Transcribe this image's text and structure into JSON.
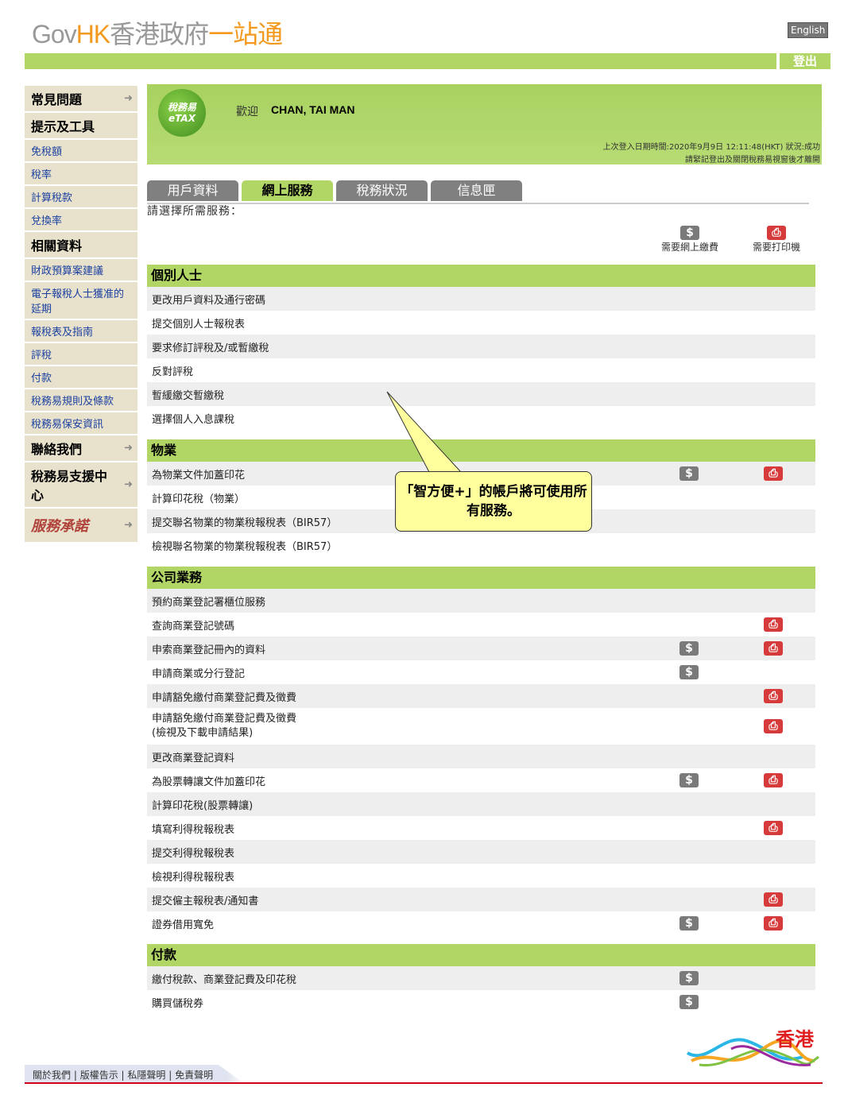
{
  "header": {
    "logo_parts": [
      "Gov",
      "HK",
      "香港政府",
      "一站通"
    ],
    "language_button": "English",
    "logout": "登出"
  },
  "sidebar": {
    "items": [
      {
        "label": "常見問題",
        "big": true,
        "arrow": true
      },
      {
        "label": "提示及工具",
        "big": true
      },
      {
        "label": "免稅額"
      },
      {
        "label": "稅率"
      },
      {
        "label": "計算稅款"
      },
      {
        "label": "兌換率"
      },
      {
        "label": "相關資料",
        "big": true
      },
      {
        "label": "財政預算案建議"
      },
      {
        "label": "電子報稅人士獲准的延期"
      },
      {
        "label": "報稅表及指南"
      },
      {
        "label": "評稅"
      },
      {
        "label": "付款"
      },
      {
        "label": "稅務易規則及條款"
      },
      {
        "label": "稅務易保安資訊"
      },
      {
        "label": "聯絡我們",
        "big": true,
        "arrow": true
      },
      {
        "label": "稅務易支援中心",
        "big": true,
        "arrow": true
      },
      {
        "label": "服務承諾",
        "big": true,
        "arrow": true,
        "logo": true
      }
    ]
  },
  "welcome": {
    "logo_text": "稅務易 eTAX",
    "greeting": "歡迎",
    "user_name": "CHAN, TAI MAN",
    "last_login": "上次登入日期時間:2020年9月9日  12:11:48(HKT)  狀況:成功",
    "reminder": "請緊記登出及關閉稅務易視窗後才離開"
  },
  "tabs": [
    {
      "label": "用戶資料"
    },
    {
      "label": "網上服務",
      "active": true
    },
    {
      "label": "稅務狀況"
    },
    {
      "label": "信息匣"
    }
  ],
  "prompt": "請選擇所需服務：",
  "legend": {
    "payment": "需要網上繳費",
    "printer": "需要打印機"
  },
  "sections": [
    {
      "title": "個別人士",
      "rows": [
        {
          "label": "更改用戶資料及通行密碼"
        },
        {
          "label": "提交個別人士報稅表"
        },
        {
          "label": "要求修訂評稅及/或暫繳稅"
        },
        {
          "label": "反對評稅"
        },
        {
          "label": "暫緩繳交暫繳稅"
        },
        {
          "label": "選擇個人入息課稅"
        }
      ]
    },
    {
      "title": "物業",
      "rows": [
        {
          "label": "為物業文件加蓋印花",
          "pay": true,
          "print": true
        },
        {
          "label": "計算印花稅（物業）"
        },
        {
          "label": "提交聯名物業的物業稅報稅表（BIR57）"
        },
        {
          "label": "檢視聯名物業的物業稅報稅表（BIR57）"
        }
      ]
    },
    {
      "title": "公司業務",
      "rows": [
        {
          "label": "預約商業登記署櫃位服務"
        },
        {
          "label": "查詢商業登記號碼",
          "print": true
        },
        {
          "label": "申索商業登記冊內的資料",
          "pay": true,
          "print": true
        },
        {
          "label": "申請商業或分行登記",
          "pay": true
        },
        {
          "label": "申請豁免繳付商業登記費及徵費",
          "print": true
        },
        {
          "label": "申請豁免繳付商業登記費及徵費\n(檢視及下載申請結果)",
          "print": true
        },
        {
          "label": "更改商業登記資料"
        },
        {
          "label": "為股票轉讓文件加蓋印花",
          "pay": true,
          "print": true
        },
        {
          "label": "計算印花稅(股票轉讓)"
        },
        {
          "label": "填寫利得稅報稅表",
          "print": true
        },
        {
          "label": "提交利得稅報稅表"
        },
        {
          "label": "檢視利得稅報稅表"
        },
        {
          "label": "提交僱主報稅表/通知書",
          "print": true
        },
        {
          "label": "證券借用寬免",
          "pay": true,
          "print": true
        }
      ]
    },
    {
      "title": "付款",
      "rows": [
        {
          "label": "繳付稅款、商業登記費及印花稅",
          "pay": true
        },
        {
          "label": "購買儲稅券",
          "pay": true
        }
      ]
    }
  ],
  "callout": "「智方便+」的帳戶將可使用所有服務。",
  "footer": {
    "links": [
      "關於我們",
      "版權告示",
      "私隱聲明",
      "免責聲明"
    ],
    "brand_text": "香港"
  },
  "icons": {
    "payment": "dollar-icon",
    "printer": "printer-icon",
    "arrow": "arrow-right-icon"
  },
  "colors": {
    "green": "#b2d665",
    "tab_gray": "#808080",
    "printer_red": "#d63a3a",
    "callout": "#ffff9e",
    "footer_line": "#d0021b"
  }
}
